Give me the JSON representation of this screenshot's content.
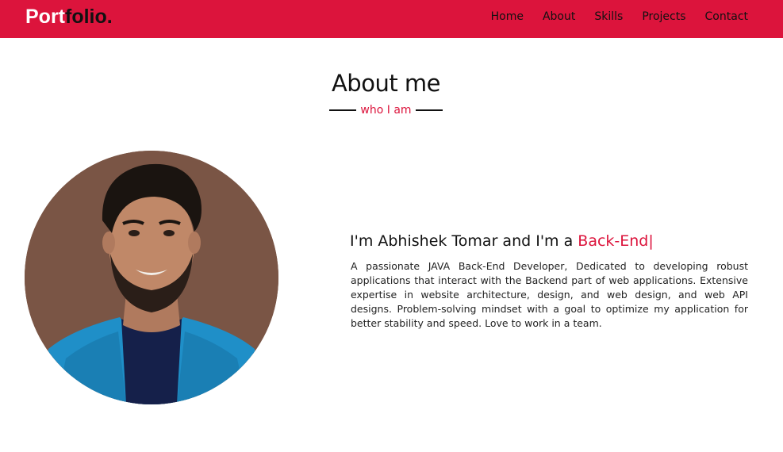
{
  "nav": {
    "logo_part1": "Port",
    "logo_part2": "folio.",
    "items": [
      "Home",
      "About",
      "Skills",
      "Projects",
      "Contact"
    ]
  },
  "about": {
    "title": "About me",
    "subtitle": "who I am",
    "heading_prefix": "I'm Abhishek Tomar and I'm a ",
    "role": "Back-End",
    "cursor": "|",
    "description": "A passionate JAVA Back-End Developer, Dedicated to developing robust applications that interact with the Backend part of web applications. Extensive expertise in website architecture, design, and web design, and web API designs. Problem-solving mindset with a goal to optimize my application for better stability and speed. Love to work in a team."
  },
  "colors": {
    "accent": "#dc143c",
    "text": "#111111",
    "avatar_bg": "#7a5545"
  }
}
